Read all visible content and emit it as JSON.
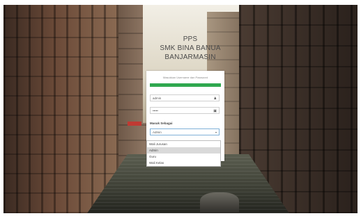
{
  "header": {
    "line1": "PPS",
    "line2": "SMK BINA BANUA",
    "line3": "BANJARMASIN"
  },
  "login": {
    "hint": "Masukkan Username dan Password",
    "progress_fraction": 1.0,
    "progress_color": "#2fa84f",
    "username_value": "admin",
    "password_value": "•••••",
    "role_label": "Masuk Sebagai",
    "role_selected": "Admin",
    "role_options": [
      "Wali Jurusan",
      "Admin",
      "Guru",
      "Wali Kelas"
    ],
    "role_highlighted_index": 1
  },
  "icons": {
    "username": "user-icon",
    "password": "lock-icon",
    "select": "chevron-down-icon"
  }
}
